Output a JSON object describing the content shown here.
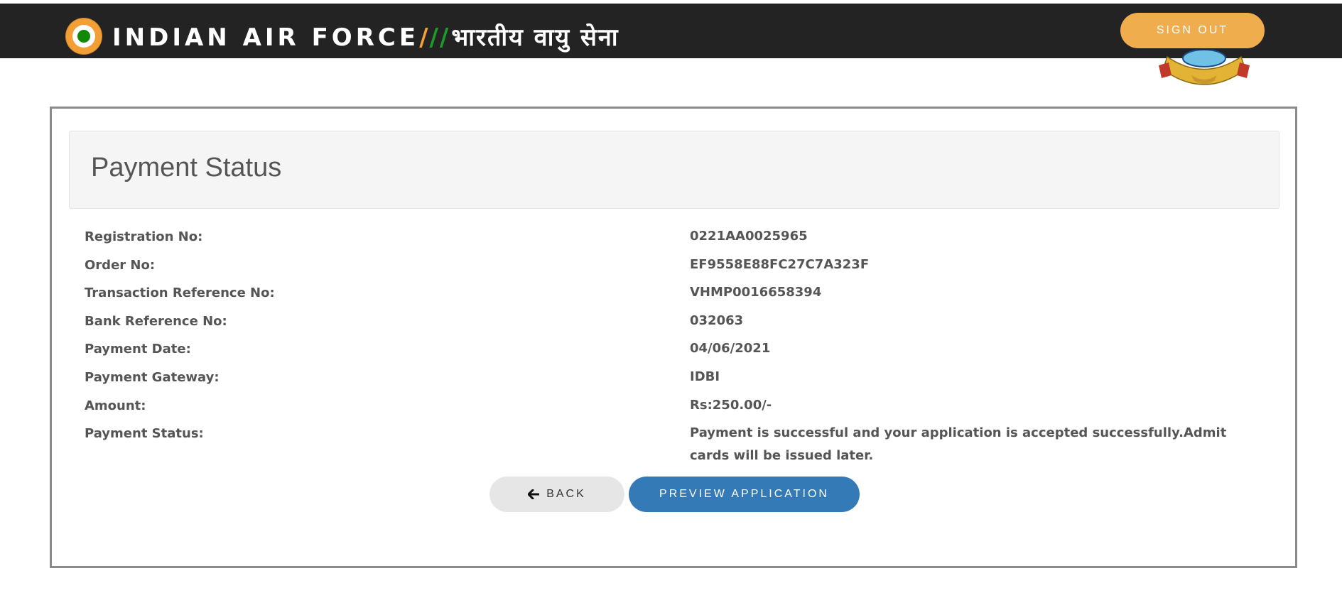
{
  "header": {
    "brand_en": "INDIAN AIR FORCE",
    "slash_orange": "/",
    "slash_green": "//",
    "brand_hi": "भारतीय वायु सेना",
    "signout_label": "SIGN OUT"
  },
  "panel": {
    "title": "Payment Status"
  },
  "details": [
    {
      "label": "Registration No:",
      "value": "0221AA0025965"
    },
    {
      "label": "Order No:",
      "value": "EF9558E88FC27C7A323F"
    },
    {
      "label": "Transaction Reference No:",
      "value": "VHMP0016658394"
    },
    {
      "label": "Bank Reference No:",
      "value": "032063"
    },
    {
      "label": "Payment Date:",
      "value": "04/06/2021"
    },
    {
      "label": "Payment Gateway:",
      "value": "IDBI"
    },
    {
      "label": "Amount:",
      "value": "Rs:250.00/-"
    },
    {
      "label": "Payment Status:",
      "value": "Payment is successful and your application is accepted successfully.Admit cards will be issued later."
    }
  ],
  "actions": {
    "back_label": "BACK",
    "preview_label": "PREVIEW APPLICATION"
  },
  "colors": {
    "header_bg": "#232323",
    "accent_orange": "#efad4e",
    "primary_blue": "#337ab7",
    "roundel_green": "#128807"
  }
}
